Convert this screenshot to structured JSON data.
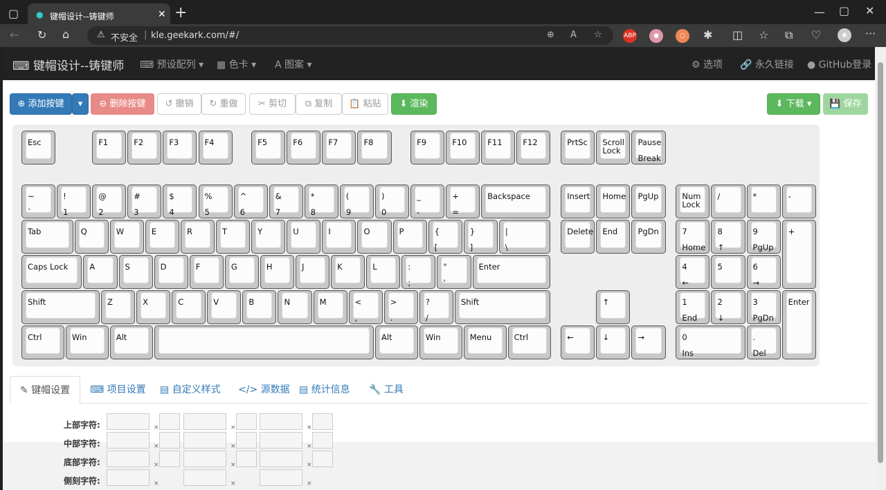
{
  "browser": {
    "tab_title": "键帽设计--铸键师",
    "address_warning": "不安全",
    "url": "kle.geekark.com/#/",
    "new_tab": "+"
  },
  "nav": {
    "brand": "键帽设计--铸键师",
    "presets": "预设配列",
    "colors": "色卡",
    "patterns": "图案",
    "options": "选项",
    "permalink": "永久链接",
    "github": "GitHub登录"
  },
  "toolbar": {
    "add_key": "添加按键",
    "delete_key": "删除按键",
    "undo": "撤销",
    "redo": "重做",
    "cut": "剪切",
    "copy": "复制",
    "paste": "粘贴",
    "render": "渲染",
    "download": "下载",
    "save": "保存"
  },
  "tabs": {
    "keycap": "键帽设置",
    "project": "项目设置",
    "custom_style": "自定义样式",
    "source": "源数据",
    "stats": "统计信息",
    "tools": "工具"
  },
  "form": {
    "top": "上部字符:",
    "middle": "中部字符:",
    "bottom": "底部字符:",
    "side": "侧刻字符:",
    "x": "×"
  },
  "keys": {
    "esc": [
      "Esc",
      ""
    ],
    "f1": [
      "F1",
      ""
    ],
    "f2": [
      "F2",
      ""
    ],
    "f3": [
      "F3",
      ""
    ],
    "f4": [
      "F4",
      ""
    ],
    "f5": [
      "F5",
      ""
    ],
    "f6": [
      "F6",
      ""
    ],
    "f7": [
      "F7",
      ""
    ],
    "f8": [
      "F8",
      ""
    ],
    "f9": [
      "F9",
      ""
    ],
    "f10": [
      "F10",
      ""
    ],
    "f11": [
      "F11",
      ""
    ],
    "f12": [
      "F12",
      ""
    ],
    "prtsc": [
      "PrtSc",
      ""
    ],
    "scroll": [
      "Scroll\nLock",
      ""
    ],
    "pause": [
      "Pause",
      "Break"
    ],
    "tilde": [
      "~",
      "`"
    ],
    "k1": [
      "!",
      "1"
    ],
    "k2": [
      "@",
      "2"
    ],
    "k3": [
      "#",
      "3"
    ],
    "k4": [
      "$",
      "4"
    ],
    "k5": [
      "%",
      "5"
    ],
    "k6": [
      "^",
      "6"
    ],
    "k7": [
      "&",
      "7"
    ],
    "k8": [
      "*",
      "8"
    ],
    "k9": [
      "(",
      "9"
    ],
    "k0": [
      ")",
      "0"
    ],
    "minus": [
      "_",
      "-"
    ],
    "equal": [
      "+",
      "="
    ],
    "backspace": [
      "Backspace",
      ""
    ],
    "insert": [
      "Insert",
      ""
    ],
    "home": [
      "Home",
      ""
    ],
    "pgup": [
      "PgUp",
      ""
    ],
    "numlock": [
      "Num\nLock",
      ""
    ],
    "nslash": [
      "/",
      ""
    ],
    "nstar": [
      "*",
      ""
    ],
    "nminus": [
      "-",
      ""
    ],
    "tab": [
      "Tab",
      ""
    ],
    "q": [
      "Q",
      ""
    ],
    "w": [
      "W",
      ""
    ],
    "e": [
      "E",
      ""
    ],
    "r": [
      "R",
      ""
    ],
    "t": [
      "T",
      ""
    ],
    "y": [
      "Y",
      ""
    ],
    "u": [
      "U",
      ""
    ],
    "i": [
      "I",
      ""
    ],
    "o": [
      "O",
      ""
    ],
    "p": [
      "P",
      ""
    ],
    "lbr": [
      "{",
      "["
    ],
    "rbr": [
      "}",
      "]"
    ],
    "bslash": [
      "|",
      "\\"
    ],
    "delete": [
      "Delete",
      ""
    ],
    "end": [
      "End",
      ""
    ],
    "pgdn": [
      "PgDn",
      ""
    ],
    "n7": [
      "7",
      "Home"
    ],
    "n8": [
      "8",
      "↑"
    ],
    "n9": [
      "9",
      "PgUp"
    ],
    "nplus": [
      "+",
      ""
    ],
    "caps": [
      "Caps Lock",
      ""
    ],
    "a": [
      "A",
      ""
    ],
    "s": [
      "S",
      ""
    ],
    "d": [
      "D",
      ""
    ],
    "f": [
      "F",
      ""
    ],
    "g": [
      "G",
      ""
    ],
    "h": [
      "H",
      ""
    ],
    "j": [
      "J",
      ""
    ],
    "k": [
      "K",
      ""
    ],
    "l": [
      "L",
      ""
    ],
    "semi": [
      ":",
      ";"
    ],
    "quote": [
      "\"",
      "'"
    ],
    "enter": [
      "Enter",
      ""
    ],
    "n4": [
      "4",
      "←"
    ],
    "n5": [
      "5",
      ""
    ],
    "n6": [
      "6",
      "→"
    ],
    "lshift": [
      "Shift",
      ""
    ],
    "z": [
      "Z",
      ""
    ],
    "x": [
      "X",
      ""
    ],
    "c": [
      "C",
      ""
    ],
    "v": [
      "V",
      ""
    ],
    "b": [
      "B",
      ""
    ],
    "n": [
      "N",
      ""
    ],
    "m": [
      "M",
      ""
    ],
    "comma": [
      "<",
      ","
    ],
    "period": [
      ">",
      "."
    ],
    "slash": [
      "?",
      "/"
    ],
    "rshift": [
      "Shift",
      ""
    ],
    "up": [
      "↑",
      ""
    ],
    "n1": [
      "1",
      "End"
    ],
    "n2": [
      "2",
      "↓"
    ],
    "n3": [
      "3",
      "PgDn"
    ],
    "nenter": [
      "Enter",
      ""
    ],
    "lctrl": [
      "Ctrl",
      ""
    ],
    "lwin": [
      "Win",
      ""
    ],
    "lalt": [
      "Alt",
      ""
    ],
    "space": [
      "",
      ""
    ],
    "ralt": [
      "Alt",
      ""
    ],
    "rwin": [
      "Win",
      ""
    ],
    "menu": [
      "Menu",
      ""
    ],
    "rctrl": [
      "Ctrl",
      ""
    ],
    "left": [
      "←",
      ""
    ],
    "down": [
      "↓",
      ""
    ],
    "right": [
      "→",
      ""
    ],
    "n0": [
      "0",
      "Ins"
    ],
    "ndot": [
      ".",
      "Del"
    ]
  }
}
